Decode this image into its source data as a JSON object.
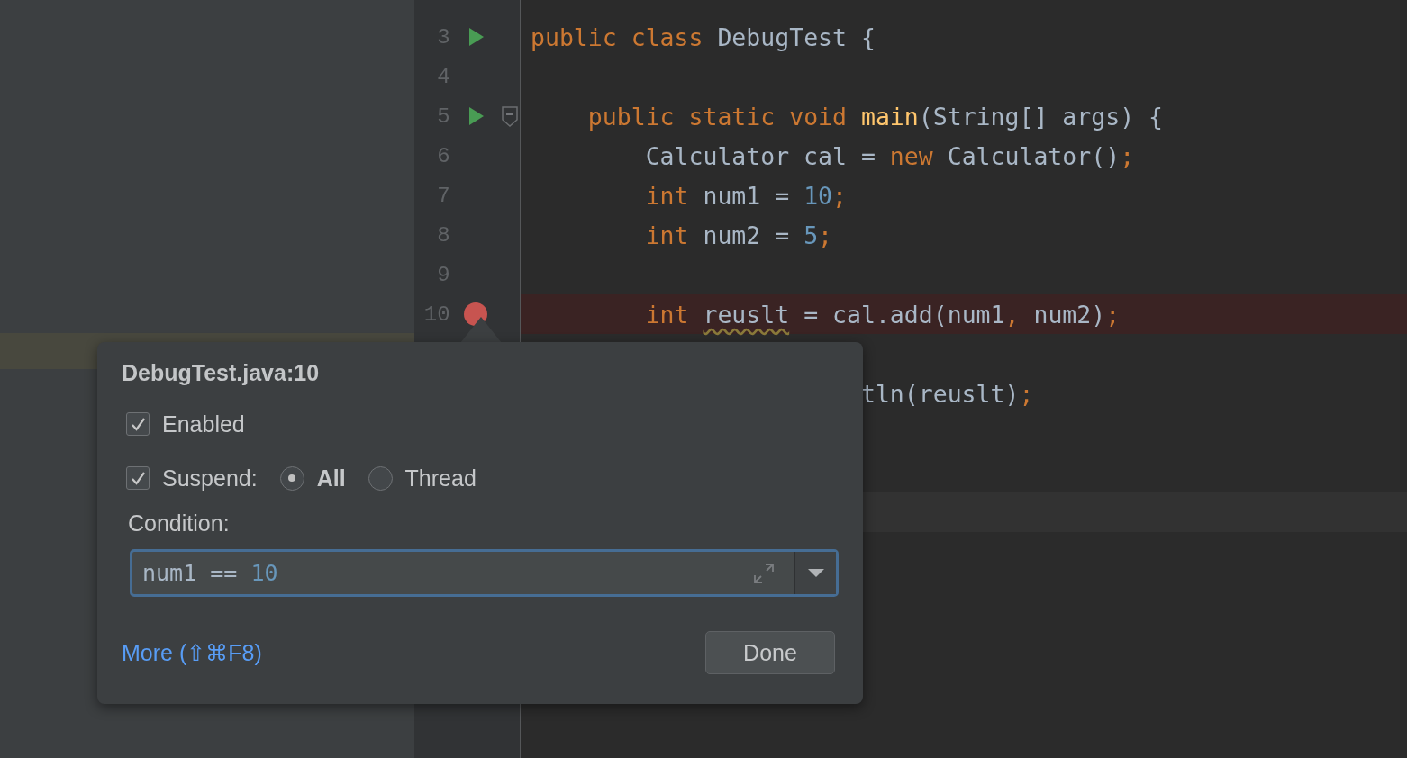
{
  "editor": {
    "lines": [
      {
        "number": "3",
        "runnable": true,
        "tokens": [
          {
            "t": "public class",
            "kind": "keyword"
          },
          {
            "t": " DebugTest {",
            "kind": "plain"
          }
        ]
      },
      {
        "number": "4"
      },
      {
        "number": "5",
        "runnable": true,
        "fold": true,
        "kind": "member",
        "tokens": [
          {
            "t": "public static void ",
            "kind": "keyword"
          },
          {
            "t": "main",
            "kind": "method"
          },
          {
            "t": "(String[] args) {",
            "kind": "plain"
          }
        ]
      },
      {
        "number": "6",
        "kind": "statement",
        "tokens": [
          {
            "t": "Calculator cal = ",
            "kind": "plain"
          },
          {
            "t": "new",
            "kind": "keyword"
          },
          {
            "t": " Calculator()",
            "kind": "plain"
          },
          {
            "t": ";",
            "kind": "punct"
          }
        ]
      },
      {
        "number": "7",
        "kind": "statement",
        "tokens": [
          {
            "t": "int",
            "kind": "keyword"
          },
          {
            "t": " num1 = ",
            "kind": "plain"
          },
          {
            "t": "10",
            "kind": "number"
          },
          {
            "t": ";",
            "kind": "punct"
          }
        ]
      },
      {
        "number": "8",
        "kind": "statement",
        "tokens": [
          {
            "t": "int",
            "kind": "keyword"
          },
          {
            "t": " num2 = ",
            "kind": "plain"
          },
          {
            "t": "5",
            "kind": "number"
          },
          {
            "t": ";",
            "kind": "punct"
          }
        ]
      },
      {
        "number": "9"
      },
      {
        "number": "10",
        "breakpoint": true,
        "kind": "statement",
        "tokens": [
          {
            "t": "int ",
            "kind": "keyword"
          },
          {
            "t": "reuslt",
            "kind": "plain",
            "warning": true
          },
          {
            "t": " = cal.add(num1",
            "kind": "plain"
          },
          {
            "t": ",",
            "kind": "punct"
          },
          {
            "t": " num2)",
            "kind": "plain"
          },
          {
            "t": ";",
            "kind": "punct"
          }
        ]
      },
      {
        "kind": "blank"
      },
      {
        "kind": "covered",
        "tokens": [
          {
            "t": "tln(reuslt)",
            "kind": "plain"
          },
          {
            "t": ";",
            "kind": "punct"
          }
        ]
      },
      {
        "kind": "blank"
      },
      {
        "kind": "blank"
      },
      {
        "kind": "blank",
        "caret_line": true
      }
    ]
  },
  "popup": {
    "title": "DebugTest.java:10",
    "enabled": {
      "label": "Enabled",
      "checked": true
    },
    "suspend": {
      "label": "Suspend:",
      "checked": true,
      "options": [
        {
          "label": "All",
          "selected": true
        },
        {
          "label": "Thread",
          "selected": false
        }
      ]
    },
    "condition": {
      "label": "Condition:",
      "tokens": [
        {
          "t": "num1 == ",
          "kind": "plain"
        },
        {
          "t": "10",
          "kind": "number"
        }
      ]
    },
    "more_link": "More (⇧⌘F8)",
    "done_button": "Done"
  }
}
